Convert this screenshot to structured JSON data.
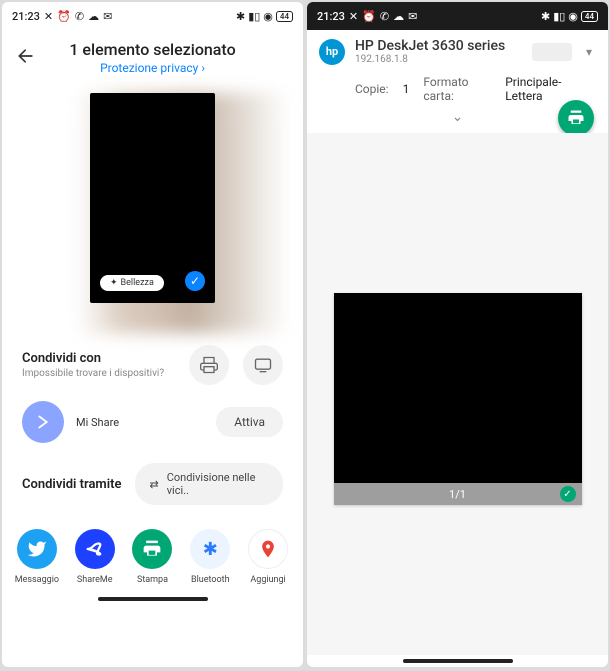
{
  "status": {
    "time": "21:23",
    "battery": "44"
  },
  "left": {
    "title": "1 elemento selezionato",
    "privacy_link": "Protezione privacy",
    "beauty_pill": "Bellezza",
    "share_with": {
      "title": "Condividi con",
      "subtitle": "Impossibile trovare i dispositivi?"
    },
    "mishare": {
      "label": "Mi Share",
      "button": "Attiva"
    },
    "share_via": {
      "title": "Condividi tramite",
      "nearby": "Condivisione nelle vici.."
    },
    "apps": [
      {
        "name": "Messaggio",
        "color": "#1DA1F2"
      },
      {
        "name": "ShareMe",
        "color": "#1e40ff"
      },
      {
        "name": "Stampa",
        "color": "#00a775"
      },
      {
        "name": "Bluetooth",
        "color": "#ecf4ff"
      },
      {
        "name": "Aggiungi",
        "color": "#fff"
      }
    ]
  },
  "right": {
    "printer_name": "HP DeskJet 3630 series",
    "printer_ip": "192.168.1.8",
    "copies_label": "Copie:",
    "copies_value": "1",
    "paper_label": "Formato carta:",
    "paper_value": "Principale-Lettera",
    "page_indicator": "1/1"
  }
}
